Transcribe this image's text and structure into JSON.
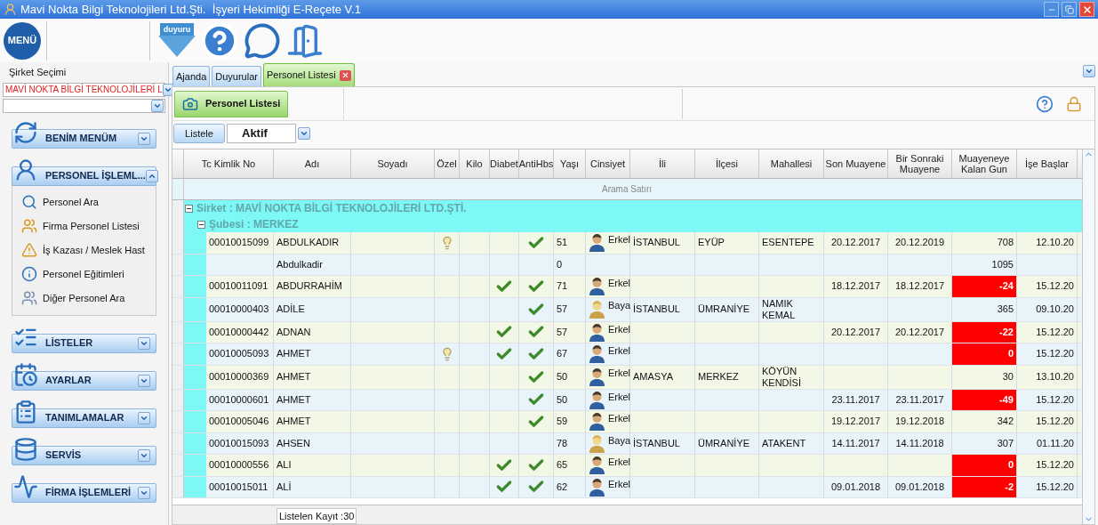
{
  "window": {
    "title": "Mavi Nokta Bilgi Teknolojileri Ltd.Şti.  İşyeri Hekimliği E-Reçete V.1"
  },
  "toolbar": {
    "menu_label": "MENÜ",
    "buttons": [
      {
        "kind": "announce",
        "label": "duyuru"
      },
      {
        "kind": "help"
      },
      {
        "kind": "chat"
      },
      {
        "kind": "exit"
      }
    ]
  },
  "sidebar": {
    "company_label": "Şirket Seçimi",
    "company_value": "MAVİ NOKTA BİLGİ TEKNOLOJİLERİ L",
    "sections": [
      {
        "kind": "favorites",
        "title": "BENİM MENÜM",
        "expanded": false
      },
      {
        "kind": "personnel",
        "title": "PERSONEL İŞLEML...",
        "expanded": true,
        "items": [
          {
            "kind": "search",
            "label": "Personel Ara"
          },
          {
            "kind": "list",
            "label": "Firma Personel Listesi"
          },
          {
            "kind": "warning",
            "label": "İş Kazası / Meslek Hast"
          },
          {
            "kind": "info",
            "label": "Personel Eğitimleri"
          },
          {
            "kind": "other",
            "label": "Diğer Personel Ara"
          }
        ]
      },
      {
        "kind": "lists",
        "title": "LİSTELER",
        "expanded": false
      },
      {
        "kind": "settings",
        "title": "AYARLAR",
        "expanded": false
      },
      {
        "kind": "definitions",
        "title": "TANIMLAMALAR",
        "expanded": false
      },
      {
        "kind": "service",
        "title": "SERVİS",
        "expanded": false
      },
      {
        "kind": "company",
        "title": "FİRMA İŞLEMLERİ",
        "expanded": false
      }
    ]
  },
  "tabs": [
    {
      "label": "Ajanda",
      "selected": false,
      "closable": false
    },
    {
      "label": "Duyurular",
      "selected": false,
      "closable": false
    },
    {
      "label": "Personel Listesi",
      "selected": true,
      "closable": true
    }
  ],
  "ribbon": {
    "button": "Personel Listesi"
  },
  "filter": {
    "list_button": "Listele",
    "status": "Aktif"
  },
  "table": {
    "columns": [
      "Tc Kimlik No",
      "Adı",
      "Soyadı",
      "Özel",
      "Kilo",
      "Diabet",
      "AntiHbs",
      "Yaşı",
      "Cinsiyet",
      "İli",
      "İlçesi",
      "Mahallesi",
      "Son Muayene",
      "Bir Sonraki Muayene",
      "Muayeneye Kalan Gun",
      "İşe Başlar"
    ],
    "search_row": "Arama Satırı",
    "groups": [
      {
        "label": "Sirket : MAVİ NOKTA BİLGİ TEKNOLOJİLERİ LTD.ŞTİ.",
        "expanded": true
      },
      {
        "label": "Şubesi : MERKEZ",
        "expanded": true
      }
    ],
    "rows": [
      {
        "tc": "00010015099",
        "name": "ABDULKADIR",
        "special": true,
        "diabetes": false,
        "antihbs": true,
        "age": "51",
        "kind": "male",
        "gender_text": "Erkel",
        "city": "İSTANBUL",
        "district": "EYÜP",
        "neighborhood": "ESENTEPE",
        "last_exam": "20.12.2017",
        "next_exam": "20.12.2019",
        "days_left": "708",
        "overdue": false,
        "start_date": "12.10.20"
      },
      {
        "name": "Abdulkadir",
        "special": false,
        "diabetes": false,
        "antihbs": false,
        "age": "0",
        "days_left": "1095",
        "overdue": false
      },
      {
        "tc": "00010011091",
        "name": "ABDURRAHİM",
        "special": false,
        "diabetes": true,
        "antihbs": true,
        "age": "71",
        "kind": "male",
        "gender_text": "Erkel",
        "last_exam": "18.12.2017",
        "next_exam": "18.12.2017",
        "days_left": "-24",
        "overdue": true,
        "start_date": "15.12.20"
      },
      {
        "tc": "00010000403",
        "name": "ADİLE",
        "special": false,
        "diabetes": false,
        "antihbs": true,
        "age": "57",
        "kind": "female",
        "gender_text": "Baya",
        "city": "İSTANBUL",
        "district": "ÜMRANİYE",
        "neighborhood": "NAMIK KEMAL",
        "days_left": "365",
        "overdue": false,
        "start_date": "09.10.20"
      },
      {
        "tc": "00010000442",
        "name": "ADNAN",
        "special": false,
        "diabetes": true,
        "antihbs": true,
        "age": "57",
        "kind": "male",
        "gender_text": "Erkel",
        "last_exam": "20.12.2017",
        "next_exam": "20.12.2017",
        "days_left": "-22",
        "overdue": true,
        "start_date": "15.12.20"
      },
      {
        "tc": "00010005093",
        "name": "AHMET",
        "special": true,
        "diabetes": true,
        "antihbs": true,
        "age": "67",
        "kind": "male",
        "gender_text": "Erkel",
        "days_left": "0",
        "overdue": true,
        "start_date": "15.12.20"
      },
      {
        "tc": "00010000369",
        "name": "AHMET",
        "special": false,
        "diabetes": false,
        "antihbs": true,
        "age": "50",
        "kind": "male",
        "gender_text": "Erkel",
        "city": "AMASYA",
        "district": "MERKEZ",
        "neighborhood": "KÖYÜN KENDİSİ",
        "days_left": "30",
        "overdue": false,
        "start_date": "13.10.20"
      },
      {
        "tc": "00010000601",
        "name": "AHMET",
        "special": false,
        "diabetes": false,
        "antihbs": true,
        "age": "50",
        "kind": "male",
        "gender_text": "Erkel",
        "last_exam": "23.11.2017",
        "next_exam": "23.11.2017",
        "days_left": "-49",
        "overdue": true,
        "start_date": "15.12.20"
      },
      {
        "tc": "00010005046",
        "name": "AHMET",
        "special": false,
        "diabetes": false,
        "antihbs": true,
        "age": "59",
        "kind": "male",
        "gender_text": "Erkel",
        "last_exam": "19.12.2017",
        "next_exam": "19.12.2018",
        "days_left": "342",
        "overdue": false,
        "start_date": "15.12.20"
      },
      {
        "tc": "00010015093",
        "name": "AHSEN",
        "special": false,
        "diabetes": false,
        "antihbs": false,
        "age": "78",
        "kind": "female",
        "gender_text": "Baya",
        "city": "İSTANBUL",
        "district": "ÜMRANİYE",
        "neighborhood": "ATAKENT",
        "last_exam": "14.11.2017",
        "next_exam": "14.11.2018",
        "days_left": "307",
        "overdue": false,
        "start_date": "01.11.20"
      },
      {
        "tc": "00010000556",
        "name": "ALI",
        "special": false,
        "diabetes": true,
        "antihbs": true,
        "age": "65",
        "kind": "male",
        "gender_text": "Erkel",
        "days_left": "0",
        "overdue": true,
        "start_date": "15.12.20"
      },
      {
        "tc": "00010015011",
        "name": "ALİ",
        "special": false,
        "diabetes": true,
        "antihbs": true,
        "age": "62",
        "kind": "male",
        "gender_text": "Erkel",
        "last_exam": "09.01.2018",
        "next_exam": "09.01.2018",
        "days_left": "-2",
        "overdue": true,
        "start_date": "15.12.20"
      }
    ]
  },
  "status_bar": {
    "count": "Listelen Kayıt :30"
  }
}
